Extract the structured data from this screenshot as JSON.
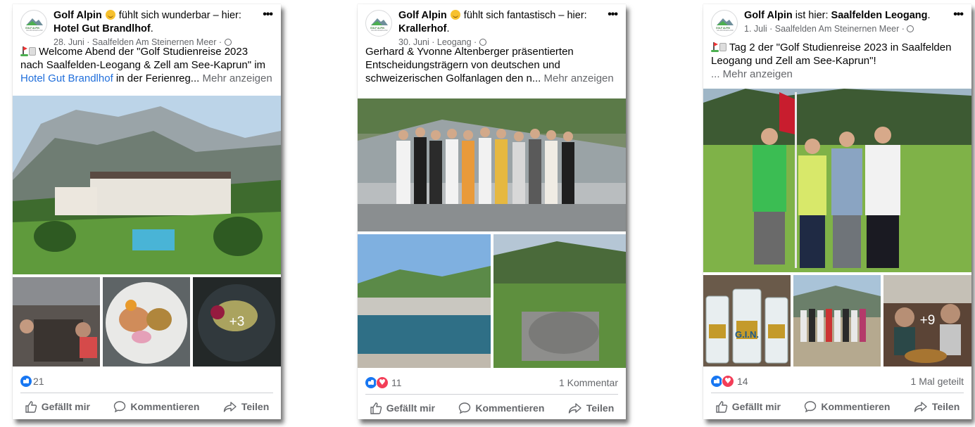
{
  "posts": [
    {
      "author": "Golf Alpin",
      "feeling": "fühlt sich wunderbar – hier:",
      "place": "Hotel Gut Brandlhof",
      "meta": "28. Juni · Saalfelden Am Steinernen Meer ·",
      "text_before": "Welcome Abend der \"Golf Studienreise 2023 nach Saalfelden-Leogang & Zell am See-Kaprun\" im",
      "text_link": "Hotel Gut Brandlhof",
      "text_after": "in der Ferienreg...",
      "more": "Mehr anzeigen",
      "photo_more": "+3",
      "reactions": "21",
      "right_stat": "",
      "like": "Gefällt mir",
      "comment": "Kommentieren",
      "share": "Teilen"
    },
    {
      "author": "Golf Alpin",
      "feeling": "fühlt sich fantastisch – hier:",
      "place": "Krallerhof",
      "meta": "30. Juni · Leogang ·",
      "text": "Gerhard & Yvonne Altenberger präsentierten Entscheidungsträgern von deutschen und schweizerischen Golfanlagen den n...",
      "more": "Mehr anzeigen",
      "reactions": "11",
      "right_stat": "1 Kommentar",
      "like": "Gefällt mir",
      "comment": "Kommentieren",
      "share": "Teilen"
    },
    {
      "author": "Golf Alpin",
      "checkin": "ist hier:",
      "place": "Saalfelden Leogang",
      "meta": "1. Juli · Saalfelden Am Steinernen Meer ·",
      "text": "Tag 2 der \"Golf Studienreise 2023 in Saalfelden Leogang und Zell am See-Kaprun\"!",
      "more": "... Mehr anzeigen",
      "photo_more": "+9",
      "gin_label": "G.I.N.",
      "reactions": "14",
      "right_stat": "1 Mal geteilt",
      "like": "Gefällt mir",
      "comment": "Kommentieren",
      "share": "Teilen"
    }
  ],
  "logo_text": "GOLF ALPIN",
  "logo_sub": "SALZBURGERLAND",
  "icons": [
    "avatar-logo-icon",
    "more-options-icon",
    "globe-icon",
    "golf-flag-icon",
    "like-reaction-icon",
    "love-reaction-icon",
    "like-icon",
    "comment-icon",
    "share-icon"
  ],
  "colors": {
    "link": "#216fdb",
    "like_blue": "#1877f2",
    "love_red": "#f33e58",
    "meta_gray": "#65676b"
  }
}
